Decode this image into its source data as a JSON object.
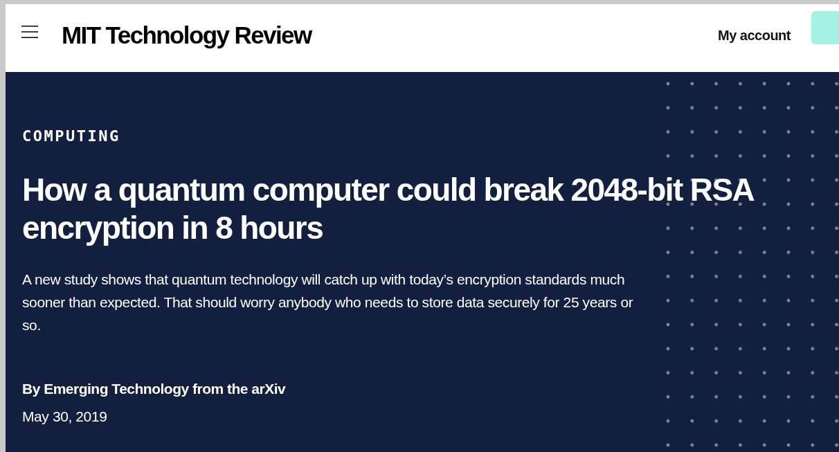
{
  "header": {
    "logo": "MIT Technology Review",
    "account_link": "My account"
  },
  "article": {
    "category": "COMPUTING",
    "title": "How a quantum computer could break 2048-bit RSA encryption in 8 hours",
    "summary": "A new study shows that quantum technology will catch up with today’s encryption standards much sooner than expected. That should worry anybody who needs to store data securely for 25 years or so.",
    "byline": "By Emerging Technology from the arXiv",
    "date": "May 30, 2019"
  }
}
